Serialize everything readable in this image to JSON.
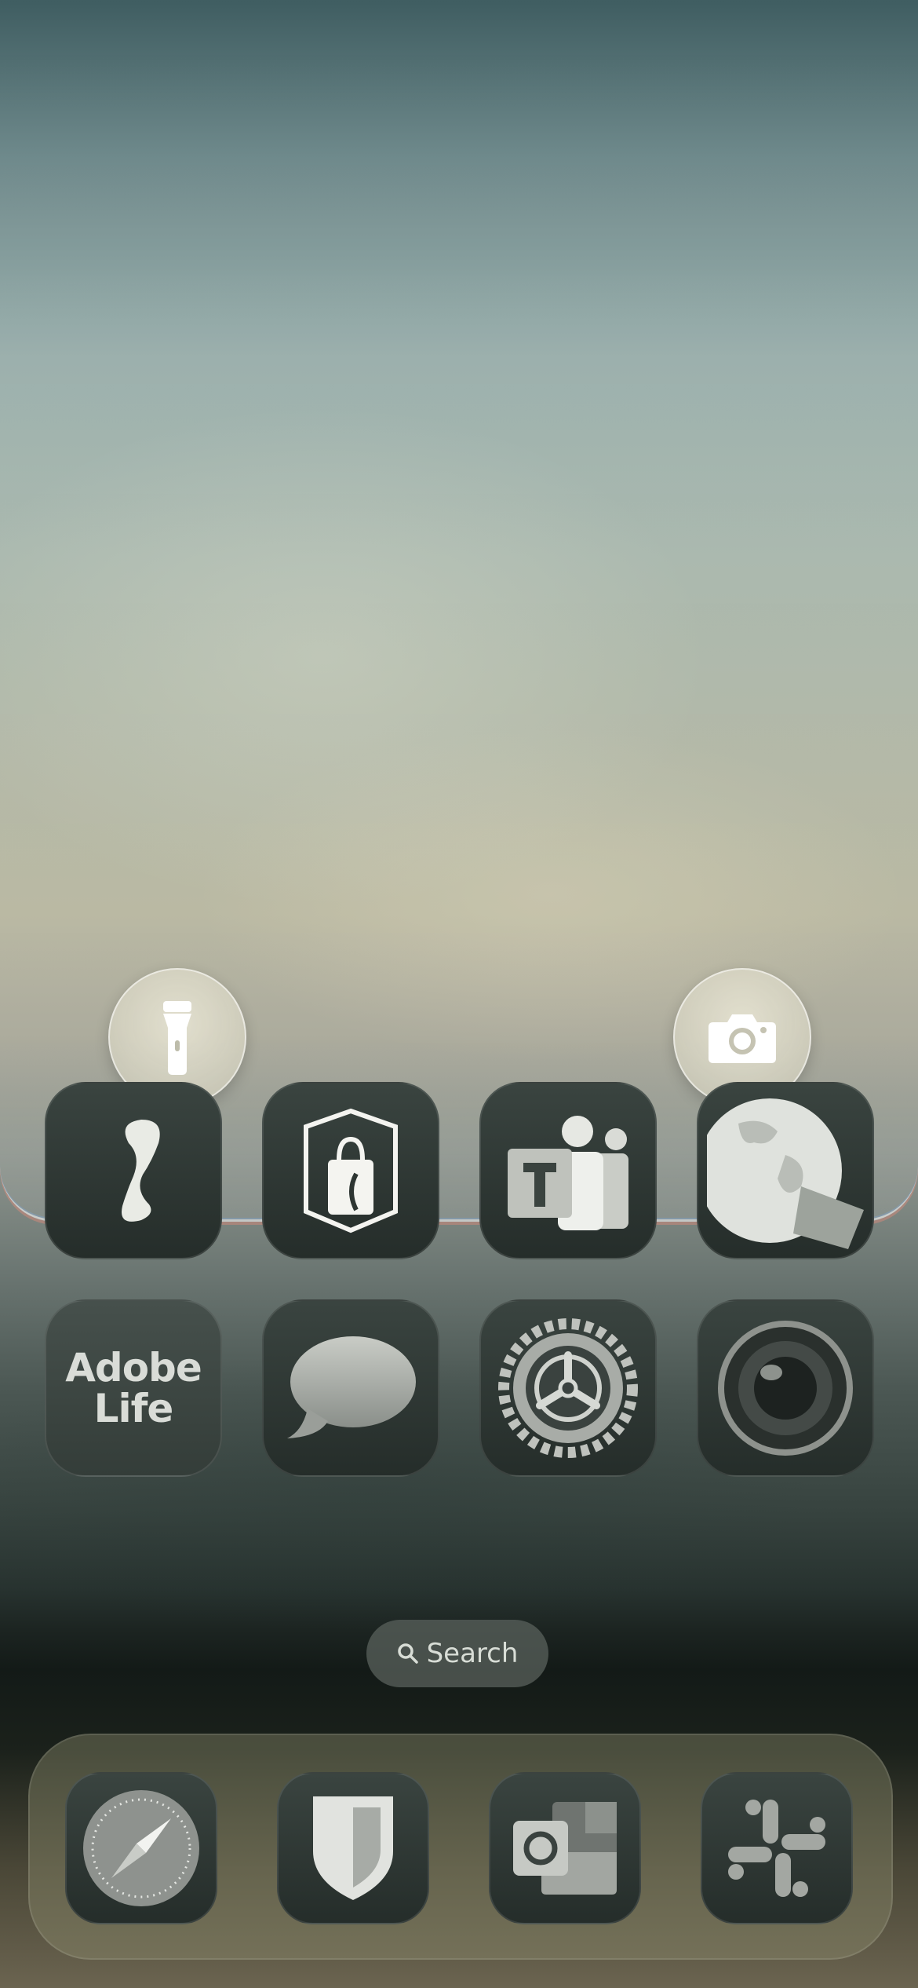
{
  "home_screen": {
    "quick_actions": [
      {
        "name": "flashlight",
        "icon": "flashlight-icon"
      },
      {
        "name": "camera",
        "icon": "camera-icon"
      }
    ],
    "row1": [
      {
        "icon": "app-squiggle-icon"
      },
      {
        "icon": "shopping-bag-icon"
      },
      {
        "icon": "teams-icon"
      },
      {
        "icon": "globe-icon"
      }
    ],
    "row2": [
      {
        "icon": "adobe-life-icon",
        "text_line1": "Adobe",
        "text_line2": "Life"
      },
      {
        "icon": "messages-icon"
      },
      {
        "icon": "settings-icon"
      },
      {
        "icon": "camera-lens-icon"
      }
    ],
    "search": {
      "label": "Search",
      "icon": "search-icon"
    },
    "dock": [
      {
        "icon": "safari-icon"
      },
      {
        "icon": "bitwarden-shield-icon"
      },
      {
        "icon": "outlook-icon"
      },
      {
        "icon": "slack-icon"
      }
    ]
  }
}
